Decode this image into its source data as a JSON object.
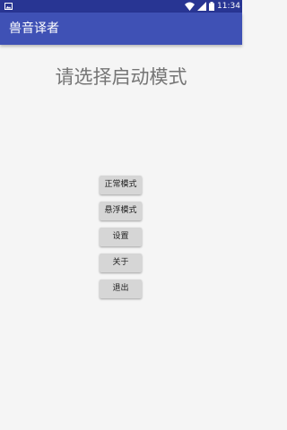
{
  "status_bar": {
    "time": "11:34",
    "icons": [
      "notification-icon",
      "wifi-icon",
      "signal-icon",
      "battery-icon"
    ]
  },
  "app_bar": {
    "title": "兽音译者"
  },
  "main": {
    "prompt": "请选择启动模式",
    "buttons": [
      {
        "label": "正常模式"
      },
      {
        "label": "悬浮模式"
      },
      {
        "label": "设置"
      },
      {
        "label": "关于"
      },
      {
        "label": "退出"
      }
    ]
  },
  "colors": {
    "status_bar": "#283593",
    "app_bar": "#3f51b5",
    "background": "#f5f5f5",
    "button": "#d6d6d6",
    "prompt_text": "#757575"
  }
}
